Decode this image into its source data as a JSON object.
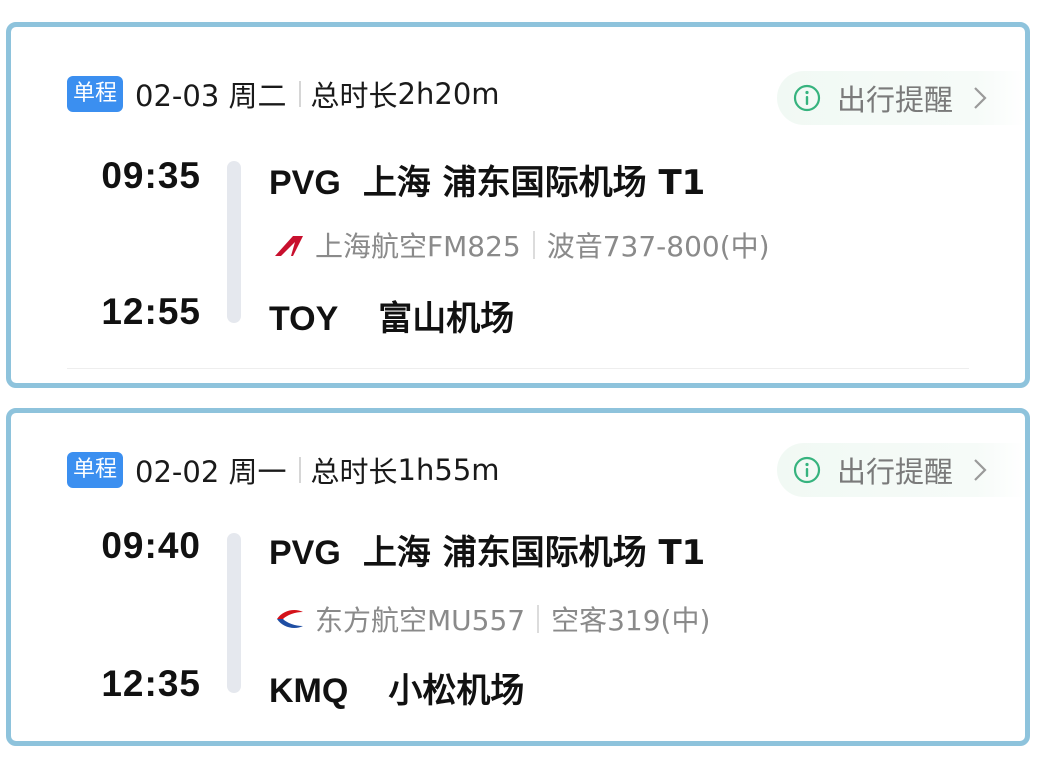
{
  "colors": {
    "card_border": "#8ec3dc",
    "badge_bg": "#3b8ff0",
    "reminder_icon": "#36b37e",
    "fm_logo": "#c8102e",
    "mu_logo_red": "#d4121a",
    "mu_logo_blue": "#1f4ea3"
  },
  "itineraries": [
    {
      "trip_type": "单程",
      "date": "02-03 周二",
      "duration_label": "总时长",
      "duration": "2h20m",
      "reminder": {
        "icon": "info-icon",
        "label": "出行提醒",
        "chevron": "chevron-right-icon"
      },
      "departure": {
        "time": "09:35",
        "code": "PVG",
        "airport": "上海 浦东国际机场 T1"
      },
      "flight": {
        "airline_icon": "shanghai-airlines-logo-icon",
        "airline_flight": "上海航空FM825",
        "aircraft": "波音737-800(中)"
      },
      "arrival": {
        "time": "12:55",
        "code": "TOY",
        "airport": "富山机场"
      }
    },
    {
      "trip_type": "单程",
      "date": "02-02 周一",
      "duration_label": "总时长",
      "duration": "1h55m",
      "reminder": {
        "icon": "info-icon",
        "label": "出行提醒",
        "chevron": "chevron-right-icon"
      },
      "departure": {
        "time": "09:40",
        "code": "PVG",
        "airport": "上海 浦东国际机场 T1"
      },
      "flight": {
        "airline_icon": "china-eastern-logo-icon",
        "airline_flight": "东方航空MU557",
        "aircraft": "空客319(中)"
      },
      "arrival": {
        "time": "12:35",
        "code": "KMQ",
        "airport": "小松机场"
      }
    }
  ]
}
